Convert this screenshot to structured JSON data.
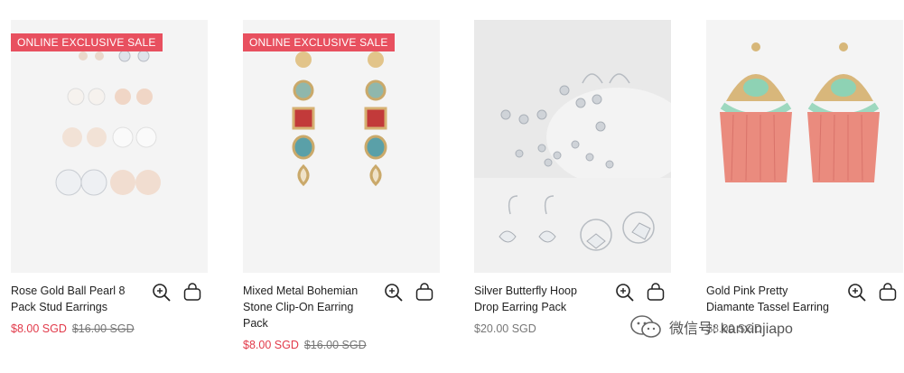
{
  "products": [
    {
      "badge": "ONLINE EXCLUSIVE SALE",
      "name": "Rose Gold Ball Pearl 8 Pack Stud Earrings",
      "sale_price": "$8.00 SGD",
      "original_price": "$16.00 SGD"
    },
    {
      "badge": "ONLINE EXCLUSIVE SALE",
      "name": "Mixed Metal Bohemian Stone Clip-On Earring Pack",
      "sale_price": "$8.00 SGD",
      "original_price": "$16.00 SGD"
    },
    {
      "badge": "",
      "name": "Silver Butterfly Hoop Drop Earring Pack",
      "price": "$20.00 SGD"
    },
    {
      "badge": "",
      "name": "Gold Pink Pretty Diamante Tassel Earring",
      "price": "$8.00 SGD"
    }
  ],
  "icons": {
    "quick_view": "zoom-in-icon",
    "add_to_bag": "shopping-bag-icon"
  },
  "colors": {
    "sale_badge": "#e8505f",
    "sale_price": "#e23a4a",
    "muted_price": "#777777"
  },
  "watermark": {
    "text": "微信号: kanxinjiapo"
  }
}
